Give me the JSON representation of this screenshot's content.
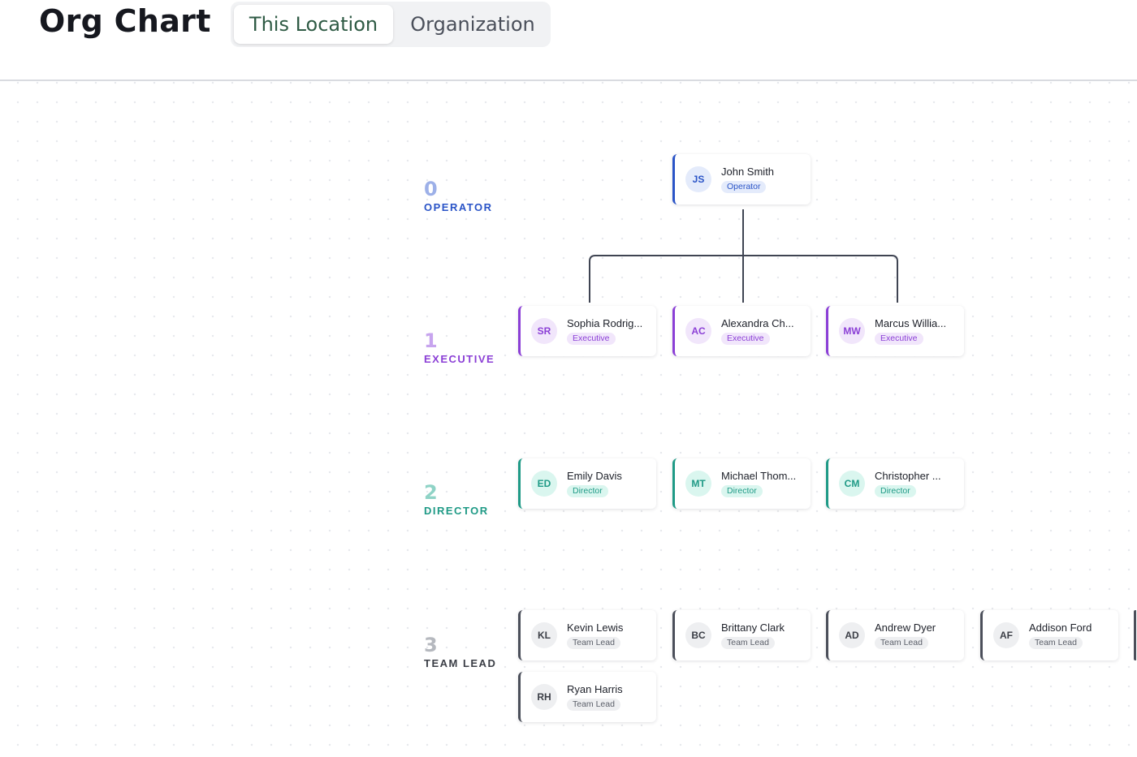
{
  "header": {
    "title": "Org Chart",
    "tabs": [
      {
        "label": "This Location",
        "active": true
      },
      {
        "label": "Organization",
        "active": false
      }
    ]
  },
  "levels": [
    {
      "number": "0",
      "name": "OPERATOR",
      "color": "#2a54c7",
      "num_color": "#9db0e8"
    },
    {
      "number": "1",
      "name": "EXECUTIVE",
      "color": "#8b3fd6",
      "num_color": "#c7a4ee"
    },
    {
      "number": "2",
      "name": "DIRECTOR",
      "color": "#1f9a86",
      "num_color": "#8fd3c6"
    },
    {
      "number": "3",
      "name": "TEAM LEAD",
      "color": "#3b3e46",
      "num_color": "#b5b8be"
    }
  ],
  "people": {
    "operator": [
      {
        "initials": "JS",
        "name": "John Smith",
        "role": "Operator"
      }
    ],
    "executive": [
      {
        "initials": "SR",
        "name": "Sophia Rodrig...",
        "role": "Executive"
      },
      {
        "initials": "AC",
        "name": "Alexandra Ch...",
        "role": "Executive"
      },
      {
        "initials": "MW",
        "name": "Marcus Willia...",
        "role": "Executive"
      }
    ],
    "director": [
      {
        "initials": "ED",
        "name": "Emily Davis",
        "role": "Director"
      },
      {
        "initials": "MT",
        "name": "Michael Thom...",
        "role": "Director"
      },
      {
        "initials": "CM",
        "name": "Christopher ...",
        "role": "Director"
      }
    ],
    "team_lead": [
      {
        "initials": "KL",
        "name": "Kevin Lewis",
        "role": "Team Lead"
      },
      {
        "initials": "BC",
        "name": "Brittany Clark",
        "role": "Team Lead"
      },
      {
        "initials": "AD",
        "name": "Andrew Dyer",
        "role": "Team Lead"
      },
      {
        "initials": "AF",
        "name": "Addison Ford",
        "role": "Team Lead"
      },
      {
        "initials": "RH",
        "name": "Ryan Harris",
        "role": "Team Lead"
      }
    ]
  }
}
